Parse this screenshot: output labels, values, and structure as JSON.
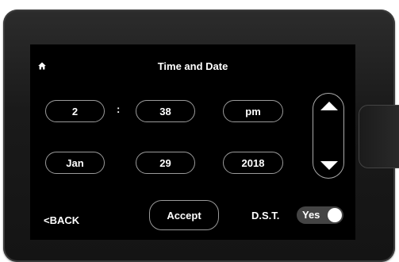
{
  "header": {
    "title": "Time and Date"
  },
  "time": {
    "hour": "2",
    "separator": ":",
    "minute": "38",
    "ampm": "pm"
  },
  "date": {
    "month": "Jan",
    "day": "29",
    "year": "2018"
  },
  "footer": {
    "back_label": "<BACK",
    "accept_label": "Accept",
    "dst_label": "D.S.T.",
    "dst_value": "Yes"
  },
  "icons": {
    "home": "home-icon",
    "up": "arrow-up-icon",
    "down": "arrow-down-icon"
  },
  "colors": {
    "screen_bg": "#000000",
    "text": "#ffffff",
    "toggle_bg": "#444444"
  }
}
